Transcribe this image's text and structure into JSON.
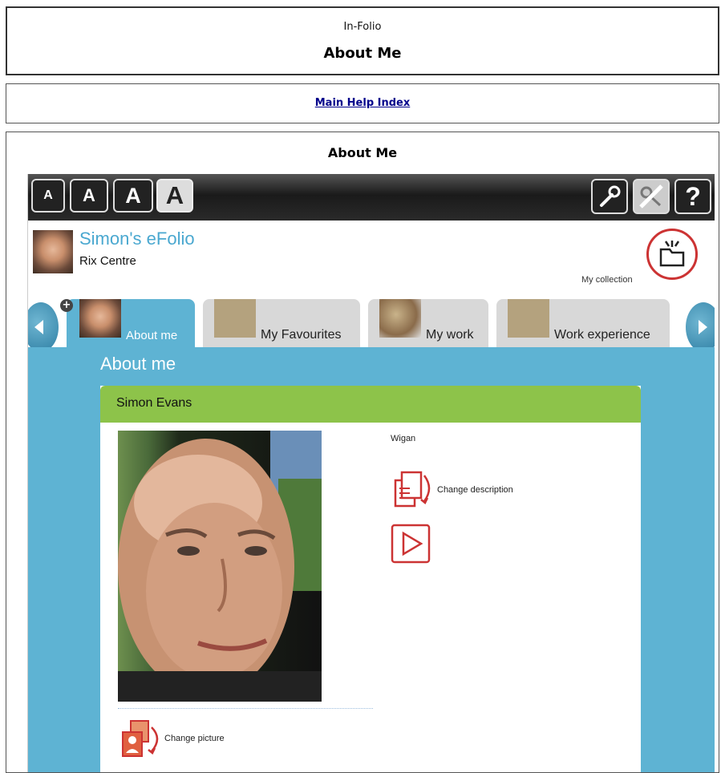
{
  "header": {
    "app_name": "In-Folio",
    "title": "About Me"
  },
  "nav": {
    "help_link": "Main Help Index"
  },
  "content": {
    "title": "About Me"
  },
  "toolbar": {
    "text_size_buttons": [
      "A",
      "A",
      "A",
      "A"
    ],
    "help_glyph": "?"
  },
  "profile": {
    "name": "Simon's eFolio",
    "organisation": "Rix Centre",
    "collection_label": "My collection"
  },
  "tabs": [
    {
      "label": "About me",
      "active": true
    },
    {
      "label": "My Favourites",
      "active": false
    },
    {
      "label": "My work",
      "active": false
    },
    {
      "label": "Work experience",
      "active": false
    }
  ],
  "add_glyph": "+",
  "panel": {
    "title": "About me",
    "card_name": "Simon Evans",
    "location": "Wigan",
    "change_description": "Change description",
    "change_picture": "Change picture"
  },
  "colors": {
    "panel_blue": "#5eb3d3",
    "card_green": "#8dc34a",
    "name_blue": "#4aa8d0",
    "icon_red": "#c33"
  }
}
